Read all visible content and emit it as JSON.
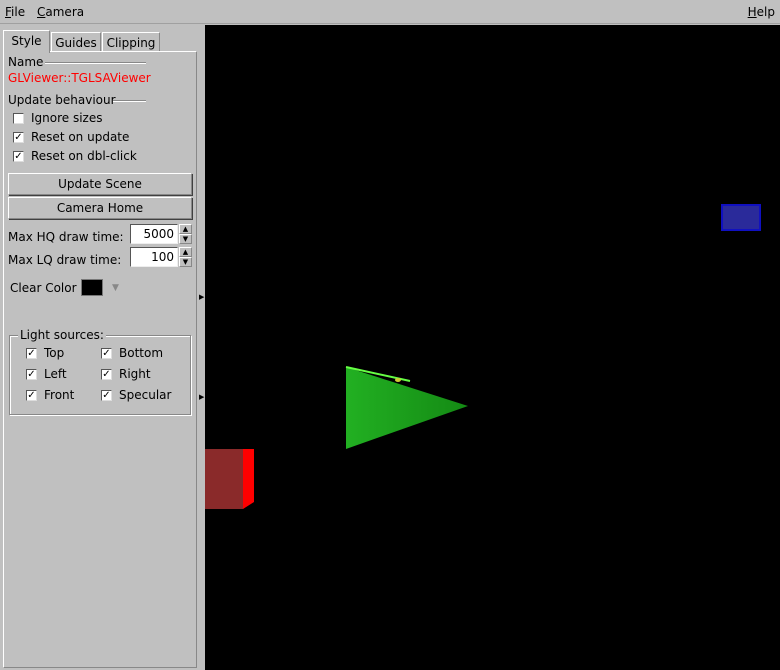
{
  "menubar": {
    "file": {
      "mnemonic": "F",
      "rest": "ile"
    },
    "camera": {
      "mnemonic": "C",
      "rest": "amera"
    },
    "help": {
      "mnemonic": "H",
      "rest": "elp"
    }
  },
  "tabs": [
    {
      "label": "Style",
      "active": true
    },
    {
      "label": "Guides",
      "active": false
    },
    {
      "label": "Clipping",
      "active": false
    }
  ],
  "style_page": {
    "name_label": "Name",
    "name_value": "GLViewer::TGLSAViewer",
    "update_behaviour_label": "Update behaviour",
    "checks": {
      "ignore_sizes": {
        "label": "Ignore sizes",
        "checked": false,
        "glyph": ""
      },
      "reset_on_update": {
        "label": "Reset on update",
        "checked": true,
        "glyph": "✓"
      },
      "reset_on_dblclick": {
        "label": "Reset on dbl-click",
        "checked": true,
        "glyph": "✓"
      }
    },
    "update_scene_button": "Update Scene",
    "camera_home_button": "Camera Home",
    "max_hq_label": "Max HQ draw time:",
    "max_hq_value": "5000",
    "max_lq_label": "Max LQ draw time:",
    "max_lq_value": "100",
    "clear_color_label": "Clear Color",
    "clear_color_value": "#000000",
    "light_sources": {
      "title": "Light sources:",
      "top": {
        "label": "Top",
        "checked": true,
        "glyph": "✓"
      },
      "bottom": {
        "label": "Bottom",
        "checked": true,
        "glyph": "✓"
      },
      "left": {
        "label": "Left",
        "checked": true,
        "glyph": "✓"
      },
      "right": {
        "label": "Right",
        "checked": true,
        "glyph": "✓"
      },
      "front": {
        "label": "Front",
        "checked": true,
        "glyph": "✓"
      },
      "specular": {
        "label": "Specular",
        "checked": true,
        "glyph": "✓"
      }
    }
  },
  "viewport": {
    "background": "#000000",
    "objects": [
      {
        "name": "green-cone",
        "color": "#1a9e1a"
      },
      {
        "name": "red-box",
        "color": "#9a2a2a"
      },
      {
        "name": "blue-box",
        "color": "#2a2a9a"
      }
    ]
  }
}
